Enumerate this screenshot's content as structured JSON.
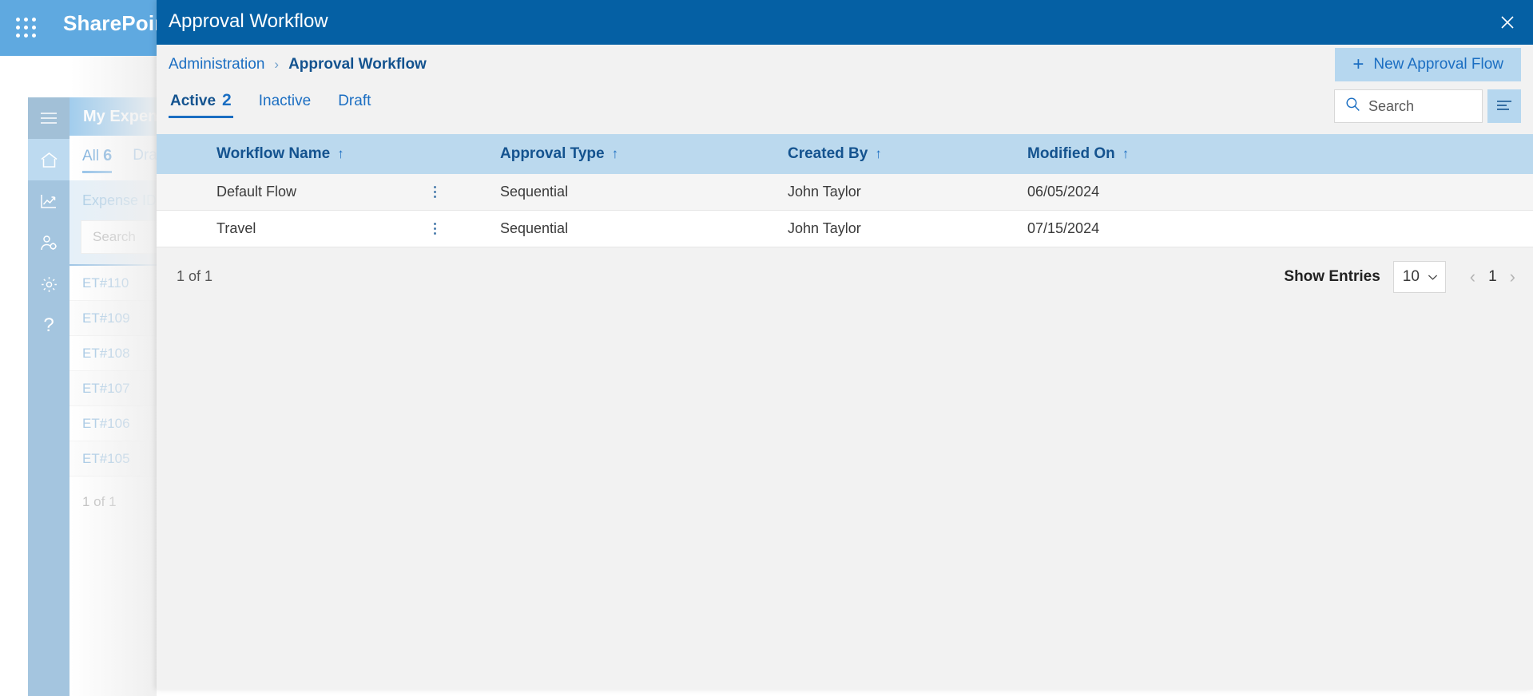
{
  "topbar": {
    "brand": "SharePoint",
    "waffle_icon": "app-launcher-icon"
  },
  "background": {
    "rail_items": [
      {
        "icon": "hamburger-icon",
        "name": "menu"
      },
      {
        "icon": "home-icon",
        "name": "home"
      },
      {
        "icon": "analytics-icon",
        "name": "reports"
      },
      {
        "icon": "user-settings-icon",
        "name": "user-admin"
      },
      {
        "icon": "gear-icon",
        "name": "settings"
      },
      {
        "icon": "question-icon",
        "name": "help"
      }
    ],
    "panel_title": "My Expenses",
    "tabs": [
      {
        "label": "All",
        "count": "6"
      },
      {
        "label": "Draft",
        "count": ""
      }
    ],
    "column_header": "Expense ID",
    "column_sort_arrow": "↑",
    "search_placeholder": "Search",
    "rows": [
      "ET#110",
      "ET#109",
      "ET#108",
      "ET#107",
      "ET#106",
      "ET#105"
    ],
    "footer": "1 of 1"
  },
  "modal": {
    "title": "Approval Workflow",
    "close_icon": "close-icon",
    "breadcrumb": {
      "parent": "Administration",
      "separator": "›",
      "current": "Approval Workflow"
    },
    "new_flow_button": {
      "label": "New Approval Flow",
      "plus": "+"
    },
    "tabs": [
      {
        "label": "Active",
        "count": "2",
        "selected": true
      },
      {
        "label": "Inactive",
        "count": "",
        "selected": false
      },
      {
        "label": "Draft",
        "count": "",
        "selected": false
      }
    ],
    "search": {
      "placeholder": "Search",
      "value": "",
      "icon": "search-icon"
    },
    "filter_button": {
      "icon": "filter-icon"
    },
    "table": {
      "sort_arrow": "↑",
      "columns": [
        "Workflow Name",
        "Approval Type",
        "Created By",
        "Modified On"
      ],
      "rows": [
        {
          "workflow_name": "Default Flow",
          "approval_type": "Sequential",
          "created_by": "John Taylor",
          "modified_on": "06/05/2024",
          "menu_icon": "kebab-menu-icon"
        },
        {
          "workflow_name": "Travel",
          "approval_type": "Sequential",
          "created_by": "John Taylor",
          "modified_on": "07/15/2024",
          "menu_icon": "kebab-menu-icon"
        }
      ]
    },
    "footer": {
      "page_info": "1 of 1",
      "show_entries_label": "Show Entries",
      "entries_value": "10",
      "prev_icon": "‹",
      "current_page": "1",
      "next_icon": "›"
    }
  },
  "colors": {
    "modal_header": "#0560a4",
    "topbar": "#5fa9e0",
    "table_header": "#bbd9ee",
    "accent_button": "#b6d7ef",
    "link_blue": "#1b6ec2",
    "rail": "#629cc8"
  }
}
